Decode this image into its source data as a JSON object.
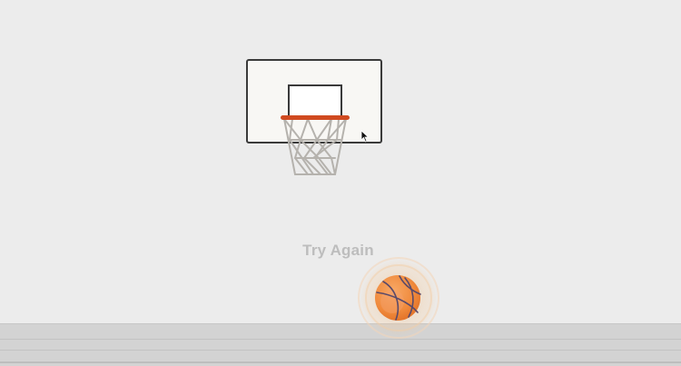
{
  "game": {
    "status_message": "Try Again"
  },
  "colors": {
    "background": "#ececec",
    "backboard": "#f8f7f4",
    "rim": "#d04a20",
    "net": "#b5b2ad",
    "ball": "#f08a3c",
    "ball_seams": "#5a4a6a",
    "message_text": "#bdbdbd",
    "floor": "#d3d3d3"
  },
  "icons": {
    "cursor": "arrow-cursor-icon",
    "ball": "basketball-icon"
  }
}
